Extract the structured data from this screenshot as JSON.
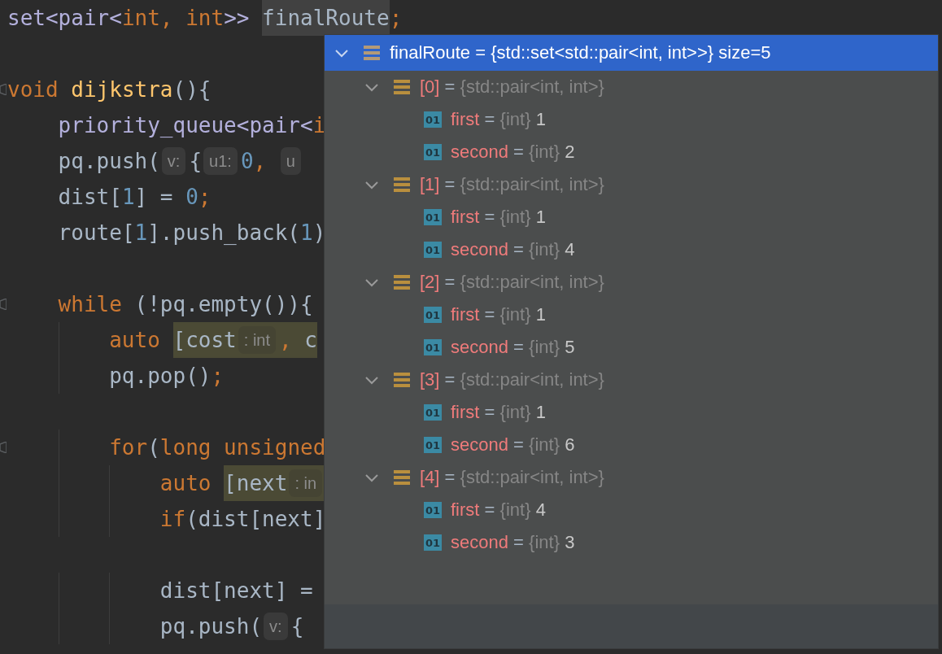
{
  "editor": {
    "lines": [
      {
        "fold": false,
        "tokens": [
          {
            "kind": "type",
            "text": "set<pair<"
          },
          {
            "kind": "kw",
            "text": "int, int"
          },
          {
            "kind": "type",
            "text": ">> "
          },
          {
            "kind": "plain",
            "text": "finalRoute",
            "usage_highlight": true
          },
          {
            "kind": "kw",
            "text": ";"
          }
        ]
      },
      {
        "fold": false
      },
      {
        "fold": true,
        "tokens": [
          {
            "kind": "kw",
            "text": "void "
          },
          {
            "kind": "fn",
            "text": "dijkstra"
          },
          {
            "kind": "plain",
            "text": "(){"
          }
        ]
      },
      {
        "fold": false,
        "tokens": [
          {
            "kind": "type",
            "text": "    priority_queue<pair<"
          },
          {
            "kind": "kw",
            "text": "i"
          }
        ]
      },
      {
        "fold": false,
        "tokens": [
          {
            "kind": "plain",
            "text": "    pq.push("
          },
          {
            "kind": "hint",
            "text": "v:"
          },
          {
            "kind": "plain",
            "text": "{"
          },
          {
            "kind": "hint",
            "text": "u1:"
          },
          {
            "kind": "num",
            "text": "0"
          },
          {
            "kind": "kw",
            "text": ", "
          },
          {
            "kind": "hint",
            "text": "u"
          }
        ]
      },
      {
        "fold": false,
        "tokens": [
          {
            "kind": "plain",
            "text": "    dist["
          },
          {
            "kind": "num",
            "text": "1"
          },
          {
            "kind": "plain",
            "text": "] = "
          },
          {
            "kind": "num",
            "text": "0"
          },
          {
            "kind": "kw",
            "text": ";"
          }
        ]
      },
      {
        "fold": false,
        "tokens": [
          {
            "kind": "plain",
            "text": "    route["
          },
          {
            "kind": "num",
            "text": "1"
          },
          {
            "kind": "plain",
            "text": "].push_back("
          },
          {
            "kind": "num",
            "text": "1"
          },
          {
            "kind": "plain",
            "text": ")"
          }
        ]
      },
      {
        "fold": false
      },
      {
        "fold": true,
        "tokens": [
          {
            "kind": "kw",
            "text": "    while "
          },
          {
            "kind": "plain",
            "text": "(!pq.empty()){"
          }
        ]
      },
      {
        "fold": false,
        "tokens": [
          {
            "kind": "kw",
            "text": "        auto "
          },
          {
            "kind": "plain",
            "text": "[cost",
            "binding_highlight": true
          },
          {
            "kind": "hint",
            "text": ": int",
            "binding_highlight": true
          },
          {
            "kind": "kw",
            "text": ", ",
            "binding_highlight": true
          },
          {
            "kind": "plain",
            "text": "c",
            "binding_highlight": true
          }
        ]
      },
      {
        "fold": false,
        "tokens": [
          {
            "kind": "plain",
            "text": "        pq.pop()"
          },
          {
            "kind": "kw",
            "text": ";"
          }
        ]
      },
      {
        "fold": false
      },
      {
        "fold": true,
        "tokens": [
          {
            "kind": "kw",
            "text": "        for"
          },
          {
            "kind": "plain",
            "text": "("
          },
          {
            "kind": "kw",
            "text": "long unsigned"
          }
        ]
      },
      {
        "fold": false,
        "tokens": [
          {
            "kind": "kw",
            "text": "            auto "
          },
          {
            "kind": "plain",
            "text": "[next",
            "binding_highlight": true
          },
          {
            "kind": "hint",
            "text": ": in",
            "binding_highlight": true
          }
        ]
      },
      {
        "fold": false,
        "tokens": [
          {
            "kind": "kw",
            "text": "            if"
          },
          {
            "kind": "plain",
            "text": "(dist[next]"
          }
        ]
      },
      {
        "fold": false
      },
      {
        "fold": false,
        "tokens": [
          {
            "kind": "plain",
            "text": "            dist[next] ="
          }
        ]
      },
      {
        "fold": false,
        "tokens": [
          {
            "kind": "plain",
            "text": "            pq.push("
          },
          {
            "kind": "hint",
            "text": "v:"
          },
          {
            "kind": "plain",
            "text": "{"
          }
        ]
      }
    ]
  },
  "debug_popup": {
    "tree": [
      {
        "kind": "collection",
        "name": "finalRoute",
        "op": "=",
        "type": "{std::set<std::pair<int, int>>}",
        "value": "size=5",
        "expanded": true,
        "selected": true,
        "children": [
          {
            "kind": "collection",
            "name": "[0]",
            "op": "=",
            "type": "{std::pair<int, int>}",
            "expanded": true,
            "selected": false,
            "children": [
              {
                "kind": "primitive",
                "icon_text": "01",
                "name": "first",
                "op": "=",
                "type": "{int}",
                "value": "1",
                "selected": false
              },
              {
                "kind": "primitive",
                "icon_text": "01",
                "name": "second",
                "op": "=",
                "type": "{int}",
                "value": "2",
                "selected": false
              }
            ]
          },
          {
            "kind": "collection",
            "name": "[1]",
            "op": "=",
            "type": "{std::pair<int, int>}",
            "expanded": true,
            "selected": false,
            "children": [
              {
                "kind": "primitive",
                "icon_text": "01",
                "name": "first",
                "op": "=",
                "type": "{int}",
                "value": "1",
                "selected": false
              },
              {
                "kind": "primitive",
                "icon_text": "01",
                "name": "second",
                "op": "=",
                "type": "{int}",
                "value": "4",
                "selected": false
              }
            ]
          },
          {
            "kind": "collection",
            "name": "[2]",
            "op": "=",
            "type": "{std::pair<int, int>}",
            "expanded": true,
            "selected": false,
            "children": [
              {
                "kind": "primitive",
                "icon_text": "01",
                "name": "first",
                "op": "=",
                "type": "{int}",
                "value": "1",
                "selected": false
              },
              {
                "kind": "primitive",
                "icon_text": "01",
                "name": "second",
                "op": "=",
                "type": "{int}",
                "value": "5",
                "selected": false
              }
            ]
          },
          {
            "kind": "collection",
            "name": "[3]",
            "op": "=",
            "type": "{std::pair<int, int>}",
            "expanded": true,
            "selected": false,
            "children": [
              {
                "kind": "primitive",
                "icon_text": "01",
                "name": "first",
                "op": "=",
                "type": "{int}",
                "value": "1",
                "selected": false
              },
              {
                "kind": "primitive",
                "icon_text": "01",
                "name": "second",
                "op": "=",
                "type": "{int}",
                "value": "6",
                "selected": false
              }
            ]
          },
          {
            "kind": "collection",
            "name": "[4]",
            "op": "=",
            "type": "{std::pair<int, int>}",
            "expanded": true,
            "selected": false,
            "children": [
              {
                "kind": "primitive",
                "icon_text": "01",
                "name": "first",
                "op": "=",
                "type": "{int}",
                "value": "4",
                "selected": false
              },
              {
                "kind": "primitive",
                "icon_text": "01",
                "name": "second",
                "op": "=",
                "type": "{int}",
                "value": "3",
                "selected": false
              }
            ]
          }
        ]
      }
    ]
  }
}
